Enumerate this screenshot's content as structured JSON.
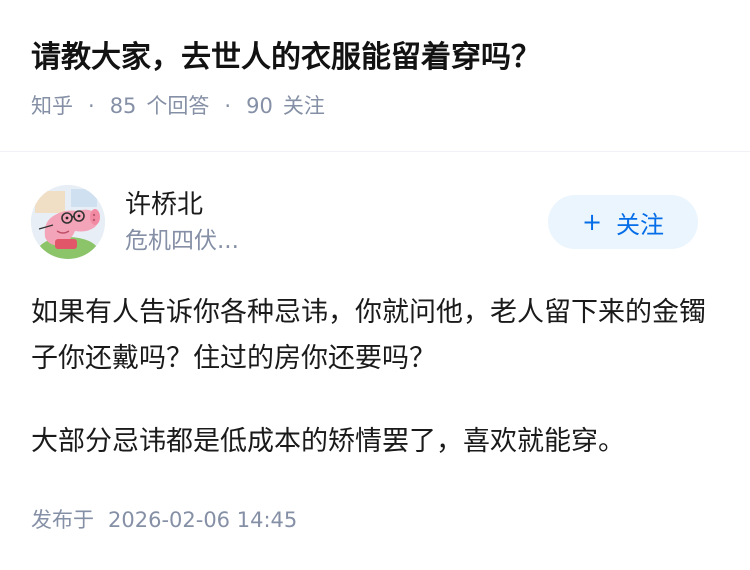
{
  "question": {
    "title": "请教大家，去世人的衣服能留着穿吗？",
    "source": "知乎",
    "answers_count": "85",
    "answers_label": "个回答",
    "follows_count": "90",
    "follows_label": "关注"
  },
  "author": {
    "name": "许桥北",
    "description": "危机四伏...",
    "avatar_icon": "peppa-pig-avatar"
  },
  "follow_button": {
    "icon": "plus-icon",
    "plus": "+",
    "label": "关注"
  },
  "answer": {
    "paragraphs": [
      "如果有人告诉你各种忌讳，你就问他，老人留下来的金镯子你还戴吗？住过的房你还要吗？",
      "大部分忌讳都是低成本的矫情罢了，喜欢就能穿。"
    ]
  },
  "footer": {
    "published_label": "发布于",
    "published_time": "2026-02-06 14:45"
  },
  "colors": {
    "accent": "#056de8",
    "accent_bg": "#ebf5fd",
    "meta_text": "#8590a6",
    "body_text": "#1a1a1a"
  }
}
